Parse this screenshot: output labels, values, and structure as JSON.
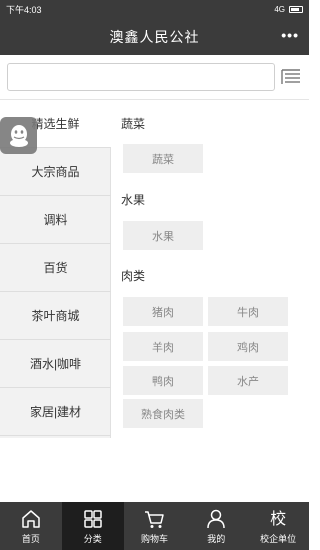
{
  "status": {
    "time": "下午4:03",
    "network": "4G"
  },
  "header": {
    "title": "澳鑫人民公社",
    "more": "•••"
  },
  "search": {
    "value": "",
    "placeholder": ""
  },
  "sidebar": {
    "items": [
      {
        "label": "精选生鲜",
        "active": true
      },
      {
        "label": "大宗商品"
      },
      {
        "label": "调料"
      },
      {
        "label": "百货"
      },
      {
        "label": "茶叶商城"
      },
      {
        "label": "酒水|咖啡"
      },
      {
        "label": "家居|建材"
      }
    ]
  },
  "sections": [
    {
      "title": "蔬菜",
      "tags": [
        "蔬菜"
      ]
    },
    {
      "title": "水果",
      "tags": [
        "水果"
      ]
    },
    {
      "title": "肉类",
      "tags": [
        "猪肉",
        "牛肉",
        "羊肉",
        "鸡肉",
        "鸭肉",
        "水产",
        "熟食肉类"
      ]
    }
  ],
  "tabbar": {
    "items": [
      {
        "label": "首页",
        "icon": "home-icon"
      },
      {
        "label": "分类",
        "icon": "grid-icon",
        "active": true
      },
      {
        "label": "购物车",
        "icon": "cart-icon"
      },
      {
        "label": "我的",
        "icon": "user-icon"
      },
      {
        "label": "校企单位",
        "icon": "school-icon",
        "glyph": "校"
      }
    ]
  },
  "colors": {
    "bar": "#3b3b3b",
    "active_tab": "#1e1e1e",
    "tag_bg": "#eeeeee",
    "sidebar_bg": "#f2f2f2"
  }
}
